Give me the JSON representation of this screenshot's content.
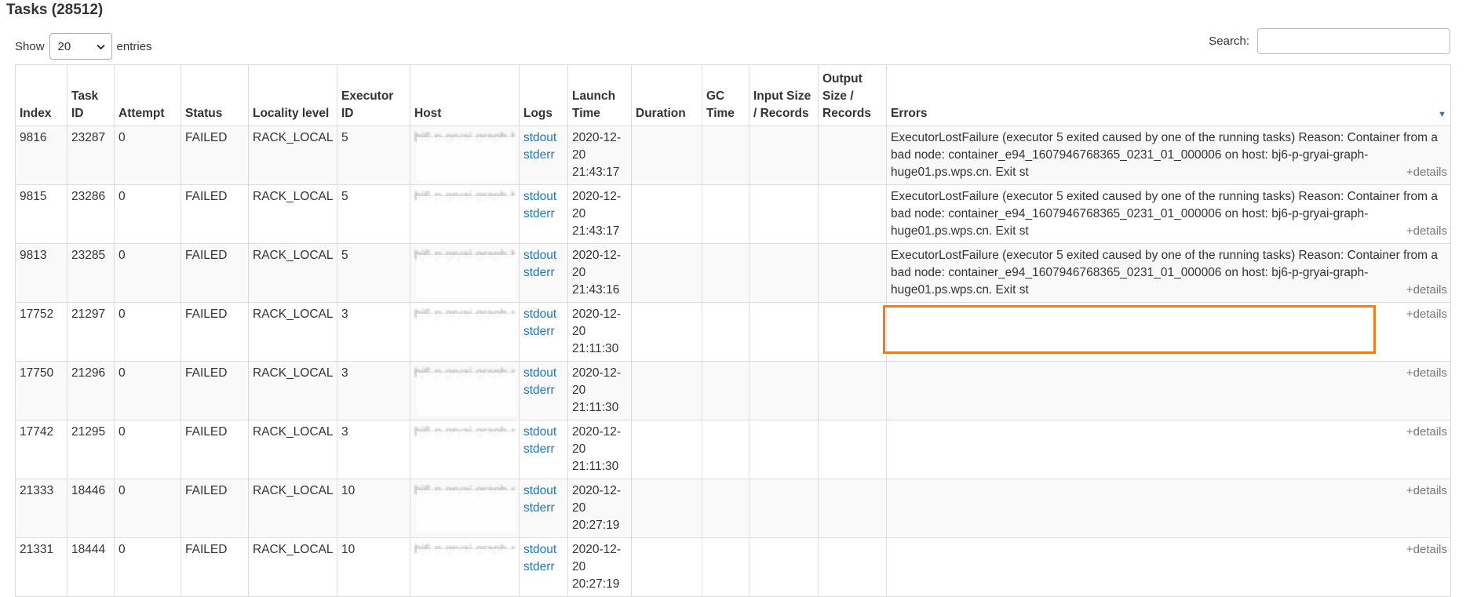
{
  "title": "Tasks (28512)",
  "length": {
    "label_show": "Show",
    "selected": "20",
    "label_entries": "entries"
  },
  "search": {
    "label": "Search:",
    "value": ""
  },
  "columns": [
    "Index",
    "Task ID",
    "Attempt",
    "Status",
    "Locality level",
    "Executor ID",
    "Host",
    "Logs",
    "Launch Time",
    "Duration",
    "GC Time",
    "Input Size / Records",
    "Output Size / Records",
    "Errors"
  ],
  "logs": {
    "stdout": "stdout",
    "stderr": "stderr"
  },
  "details_label": "+details",
  "rows": [
    {
      "index": "9816",
      "task_id": "23287",
      "attempt": "0",
      "status": "FAILED",
      "locality": "RACK_LOCAL",
      "executor": "5",
      "host": "bj6-p-gryai-graph-huge01.ps.wps.cn",
      "launch": "2020-12-20 21:43:17",
      "error": "ExecutorLostFailure (executor 5 exited caused by one of the running tasks) Reason: Container from a bad node: container_e94_1607946768365_0231_01_000006 on host: bj6-p-gryai-graph-huge01.ps.wps.cn. Exit st"
    },
    {
      "index": "9815",
      "task_id": "23286",
      "attempt": "0",
      "status": "FAILED",
      "locality": "RACK_LOCAL",
      "executor": "5",
      "host": "bj6-p-gryai-graph-huge01.ps.wps.cn",
      "launch": "2020-12-20 21:43:17",
      "error": "ExecutorLostFailure (executor 5 exited caused by one of the running tasks) Reason: Container from a bad node: container_e94_1607946768365_0231_01_000006 on host: bj6-p-gryai-graph-huge01.ps.wps.cn. Exit st"
    },
    {
      "index": "9813",
      "task_id": "23285",
      "attempt": "0",
      "status": "FAILED",
      "locality": "RACK_LOCAL",
      "executor": "5",
      "host": "bj6-p-gryai-graph-huge01.ps.wps.cn",
      "launch": "2020-12-20 21:43:16",
      "error": "ExecutorLostFailure (executor 5 exited caused by one of the running tasks) Reason: Container from a bad node: container_e94_1607946768365_0231_01_000006 on host: bj6-p-gryai-graph-huge01.ps.wps.cn. Exit st"
    },
    {
      "index": "17752",
      "task_id": "21297",
      "attempt": "0",
      "status": "FAILED",
      "locality": "RACK_LOCAL",
      "executor": "3",
      "host": "bj6-p-gryai-graph-spark10.ps.wps.cn",
      "launch": "2020-12-20 21:11:30",
      "error": ""
    },
    {
      "index": "17750",
      "task_id": "21296",
      "attempt": "0",
      "status": "FAILED",
      "locality": "RACK_LOCAL",
      "executor": "3",
      "host": "bj6-p-gryai-graph-spark10.ps.wps.cn",
      "launch": "2020-12-20 21:11:30",
      "error": ""
    },
    {
      "index": "17742",
      "task_id": "21295",
      "attempt": "0",
      "status": "FAILED",
      "locality": "RACK_LOCAL",
      "executor": "3",
      "host": "bj6-p-gryai-graph-spark10.ps.wps.cn",
      "launch": "2020-12-20 21:11:30",
      "error": ""
    },
    {
      "index": "21333",
      "task_id": "18446",
      "attempt": "0",
      "status": "FAILED",
      "locality": "RACK_LOCAL",
      "executor": "10",
      "host": "bj6-p-gryai-graph-spark10.ps.wps.cn",
      "launch": "2020-12-20 20:27:19",
      "error": ""
    },
    {
      "index": "21331",
      "task_id": "18444",
      "attempt": "0",
      "status": "FAILED",
      "locality": "RACK_LOCAL",
      "executor": "10",
      "host": "bj6-p-gryai-graph-spark10.ps.wps.cn",
      "launch": "2020-12-20 20:27:19",
      "error": ""
    }
  ],
  "colors": {
    "link": "#2077b4",
    "highlight": "#f07b1a"
  }
}
